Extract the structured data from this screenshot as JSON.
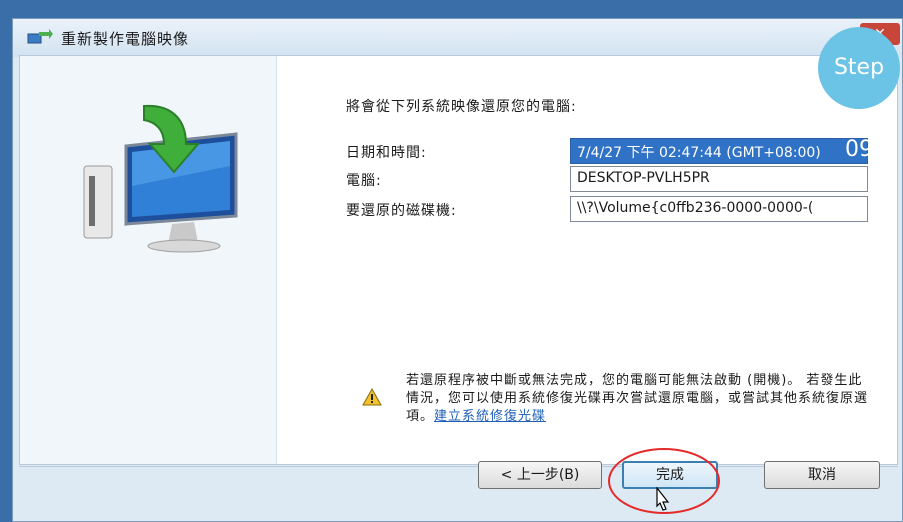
{
  "window": {
    "title": "重新製作電腦映像",
    "close_label": "✕"
  },
  "content": {
    "intro": "將會從下列系統映像還原您的電腦:",
    "rows": [
      {
        "label": "日期和時間:",
        "value": "7/4/27 下午 02:47:44 (GMT+08:00)"
      },
      {
        "label": "電腦:",
        "value": "DESKTOP-PVLH5PR"
      },
      {
        "label": "要還原的磁碟機:",
        "value": "\\\\?\\Volume{c0ffb236-0000-0000-("
      }
    ],
    "warning_text": "若還原程序被中斷或無法完成，您的電腦可能無法啟動 (開機)。 若發生此情況，您可以使用系統修復光碟再次嘗試還原電腦，或嘗試其他系統復原選項。",
    "warning_link": "建立系統修復光碟"
  },
  "buttons": {
    "back": "< 上一步(B)",
    "finish": "完成",
    "cancel": "取消"
  },
  "overlay": {
    "step_badge": "Step 09"
  },
  "icons": {
    "title": "system-restore-icon",
    "hero": "computer-restore-arrow-icon",
    "warning": "warning-triangle-icon",
    "cursor": "mouse-pointer-icon"
  },
  "colors": {
    "selection": "#3072c6",
    "badge": "#6bc4e6",
    "highlight_circle": "#e52a2a",
    "link": "#1f5fb8"
  }
}
